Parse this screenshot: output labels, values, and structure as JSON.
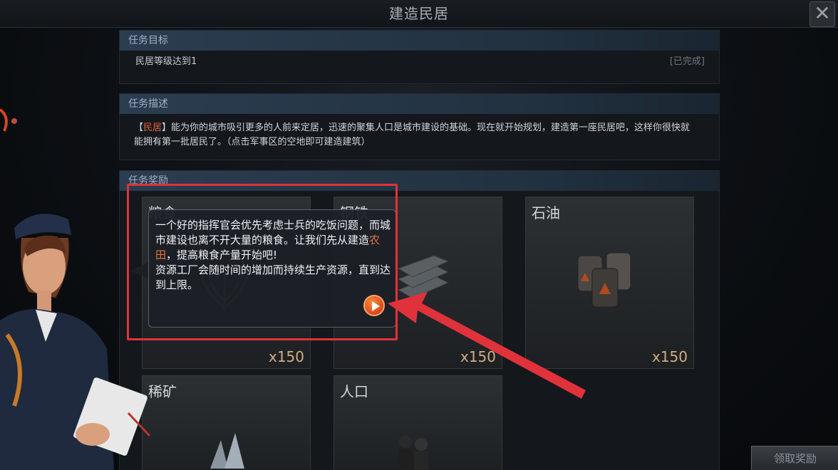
{
  "window": {
    "title": "建造民居",
    "close_glyph": "✕"
  },
  "goal": {
    "header": "任务目标",
    "text": "民居等级达到1",
    "status": "[已完成]"
  },
  "description": {
    "header": "任务描述",
    "bracket_open": "【",
    "highlight": "民居",
    "bracket_close": "】",
    "text": "能为你的城市吸引更多的人前来定居，迅速的聚集人口是城市建设的基础。现在就开始规划，建造第一座民居吧，这样你很快就能拥有第一批居民了。（点击军事区的空地即可建造建筑）"
  },
  "rewards": {
    "header": "任务奖励",
    "items": [
      {
        "name": "粮食",
        "count": "x150",
        "icon": "wheat-icon"
      },
      {
        "name": "钢铁",
        "count": "x150",
        "icon": "steel-icon"
      },
      {
        "name": "石油",
        "count": "x150",
        "icon": "oil-barrel-icon"
      },
      {
        "name": "稀矿",
        "count": "",
        "icon": "crystal-icon"
      },
      {
        "name": "人口",
        "count": "",
        "icon": "people-icon"
      }
    ]
  },
  "claim_button": "领取奖励",
  "tip": {
    "line1": "一个好的指挥官会优先考虑士兵的吃饭问题，而城市建设也离不开大量的粮食。让我们先从建造",
    "highlight": "农田",
    "line2": "，提高粮食产量开始吧!",
    "line3": "资源工厂会随时间的增加而持续生产资源，直到达到上限。"
  },
  "colors": {
    "accent_red": "#e0323a",
    "highlight_orange": "#e1623b",
    "reward_count": "#d3ad7f"
  }
}
